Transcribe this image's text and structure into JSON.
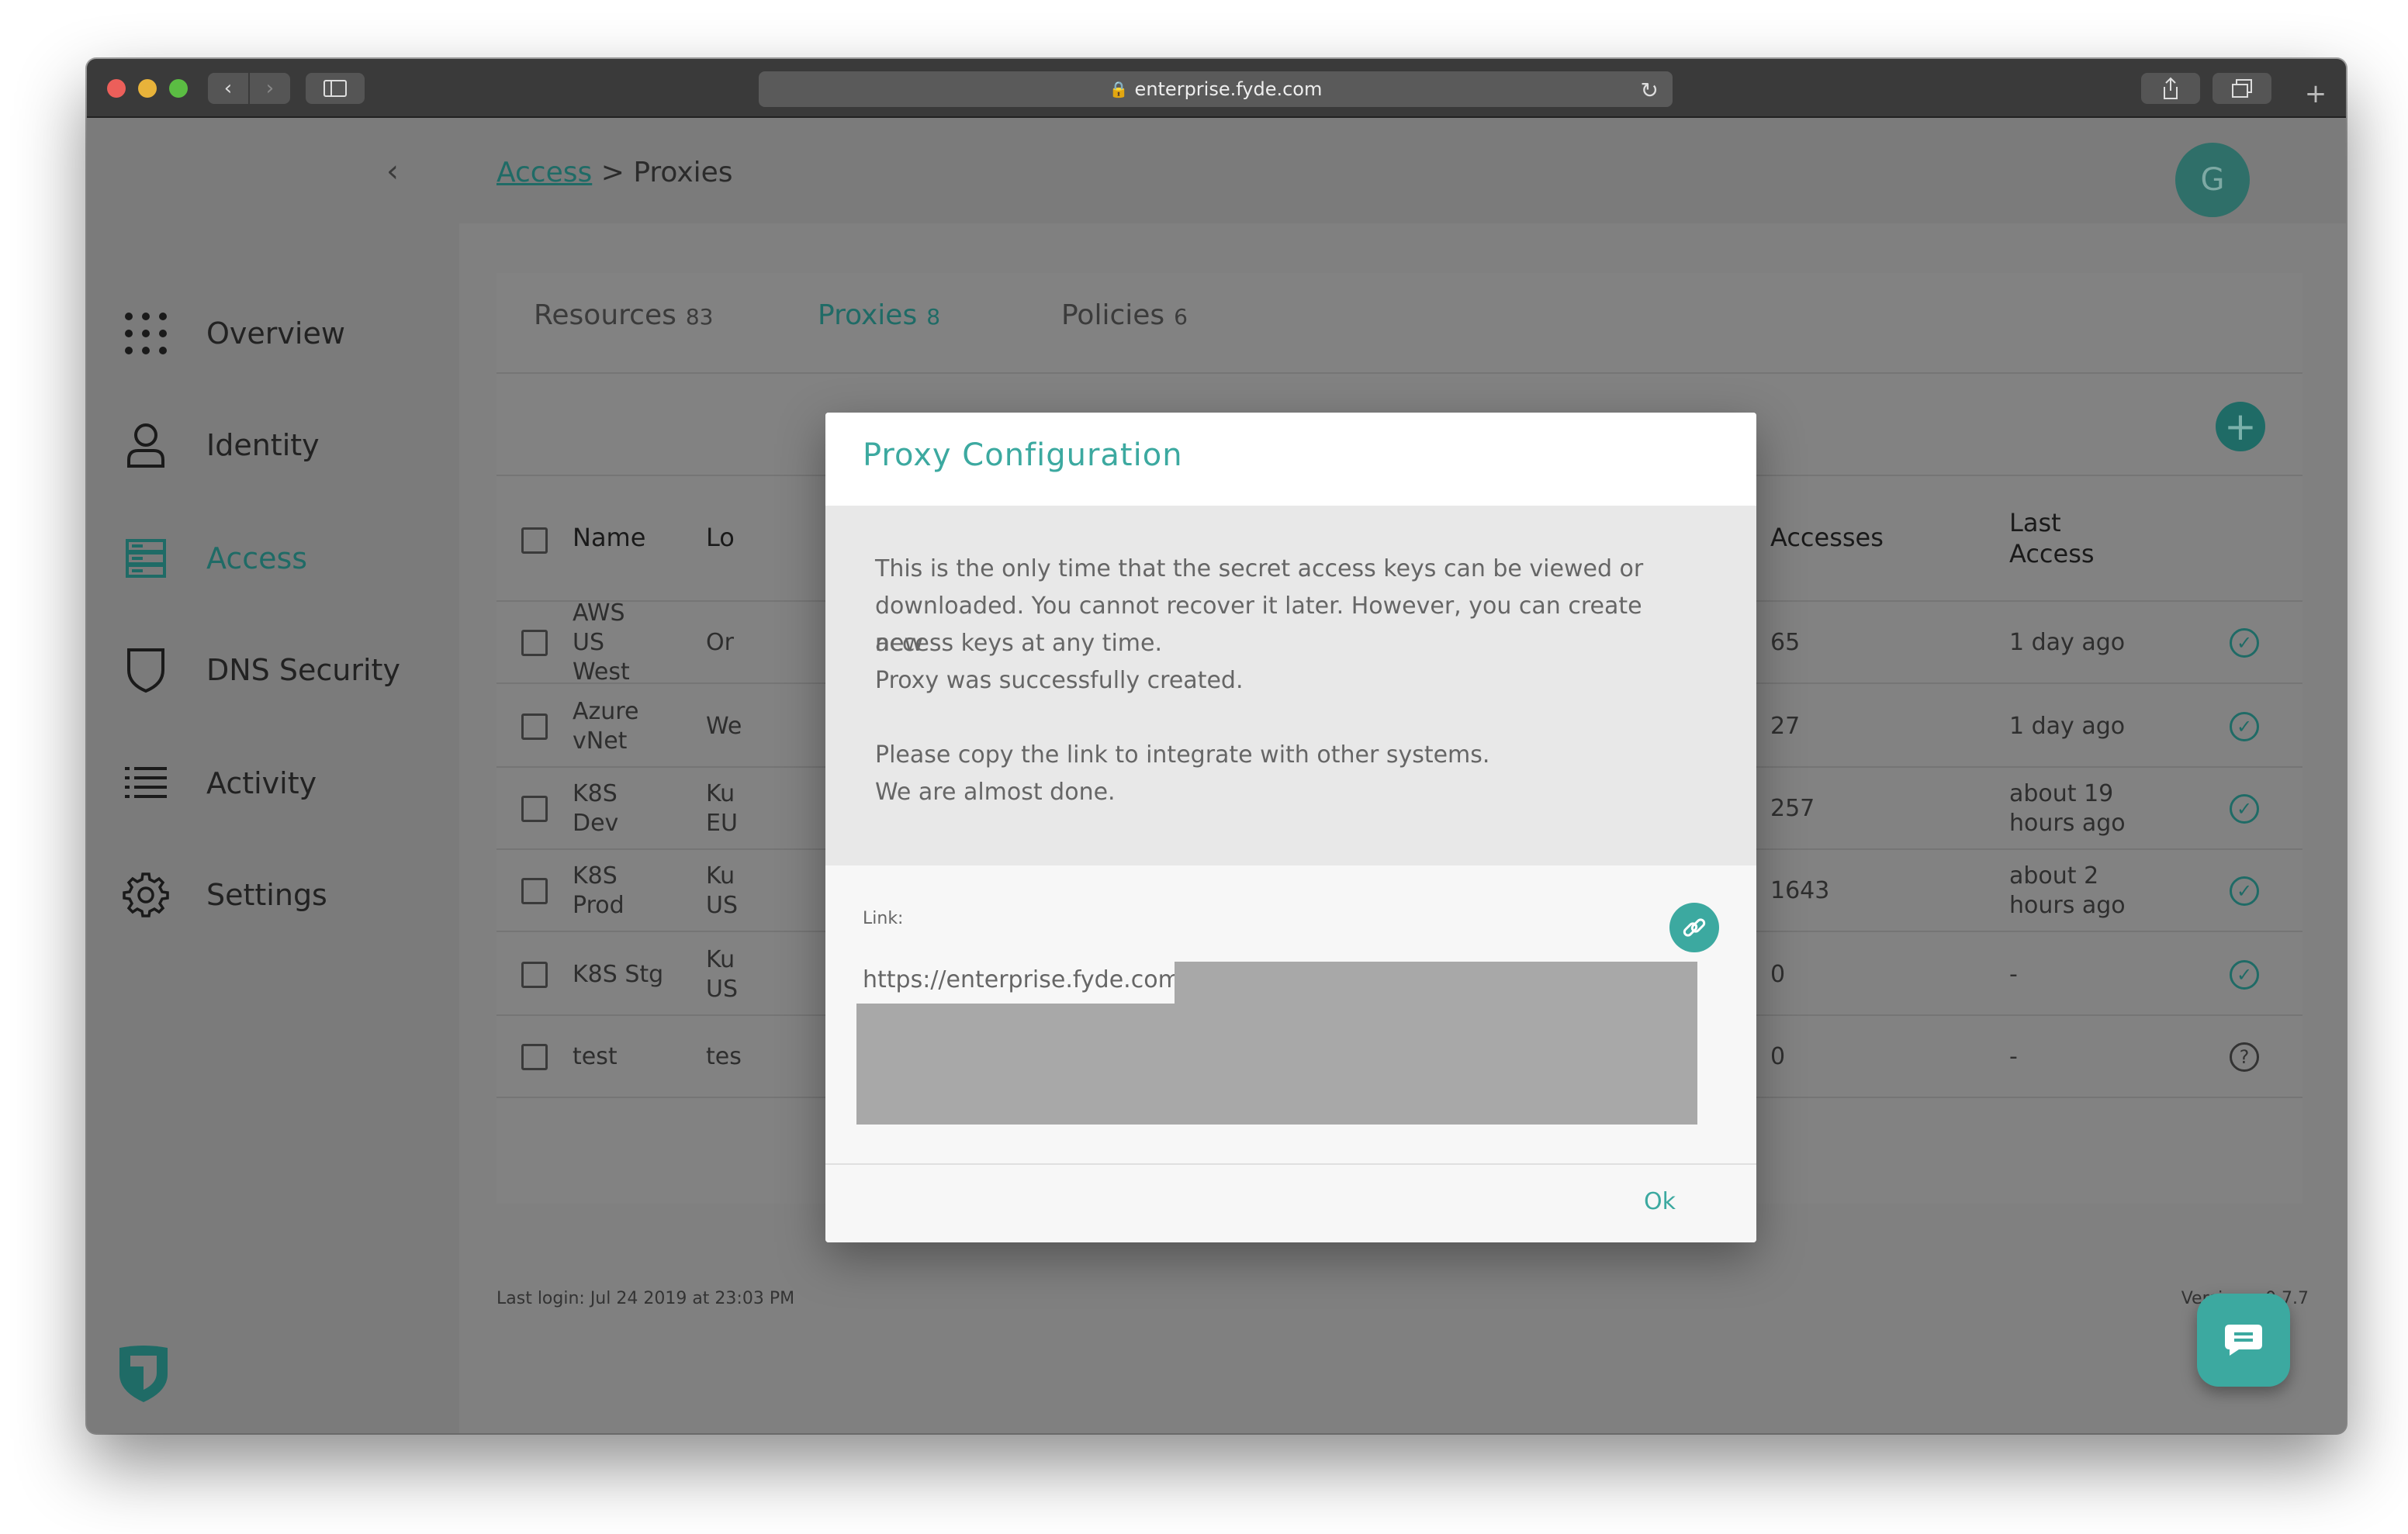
{
  "browser": {
    "url": "enterprise.fyde.com"
  },
  "header": {
    "breadcrumb_parent": "Access",
    "breadcrumb_separator": ">",
    "breadcrumb_current": "Proxies",
    "avatar_initial": "G"
  },
  "sidebar": {
    "items": [
      {
        "label": "Overview",
        "icon": "grid-dots-icon"
      },
      {
        "label": "Identity",
        "icon": "person-icon"
      },
      {
        "label": "Access",
        "icon": "server-stack-icon",
        "active": true
      },
      {
        "label": "DNS Security",
        "icon": "shield-icon"
      },
      {
        "label": "Activity",
        "icon": "list-icon"
      },
      {
        "label": "Settings",
        "icon": "gear-icon"
      }
    ]
  },
  "tabs": [
    {
      "label": "Resources",
      "count": "83"
    },
    {
      "label": "Proxies",
      "count": "8",
      "active": true
    },
    {
      "label": "Policies",
      "count": "6"
    }
  ],
  "table": {
    "columns": {
      "name": "Name",
      "location": "Lo",
      "accesses": "Accesses",
      "last_access_1": "Last",
      "last_access_2": "Access"
    },
    "rows": [
      {
        "name": [
          "AWS",
          "US",
          "West"
        ],
        "location": [
          "Or"
        ],
        "accesses": "65",
        "last_access": [
          "1 day ago"
        ],
        "status": "check"
      },
      {
        "name": [
          "Azure",
          "vNet"
        ],
        "location": [
          "We"
        ],
        "accesses": "27",
        "last_access": [
          "1 day ago"
        ],
        "status": "check"
      },
      {
        "name": [
          "K8S",
          "Dev"
        ],
        "location": [
          "Ku",
          "EU"
        ],
        "accesses": "257",
        "last_access": [
          "about 19",
          "hours ago"
        ],
        "status": "check"
      },
      {
        "name": [
          "K8S",
          "Prod"
        ],
        "location": [
          "Ku",
          "US"
        ],
        "accesses": "1643",
        "last_access": [
          "about 2",
          "hours ago"
        ],
        "status": "check"
      },
      {
        "name": [
          "K8S Stg"
        ],
        "location": [
          "Ku",
          "US"
        ],
        "accesses": "0",
        "last_access": [
          "-"
        ],
        "status": "check"
      },
      {
        "name": [
          "test"
        ],
        "location": [
          "tes"
        ],
        "accesses": "0",
        "last_access": [
          "-"
        ],
        "status": "question"
      }
    ]
  },
  "footer": {
    "last_login": "Last login: Jul 24 2019 at 23:03 PM",
    "version": "Version: v0.7.7"
  },
  "modal": {
    "title": "Proxy Configuration",
    "message_lines": [
      "This is the only time that the secret access keys can be viewed or",
      "downloaded. You cannot recover it later. However, you can create new",
      "access keys at any time.",
      "Proxy was successfully created.",
      "",
      "Please copy the link to integrate with other systems.",
      "We are almost done."
    ],
    "link_label": "Link:",
    "link_value": "https://enterprise.fyde.com/",
    "ok_label": "Ok"
  },
  "colors": {
    "accent": "#3ca9a0",
    "accent_dark_overlay": "#1f6b66",
    "overlay_gray": "#808080"
  }
}
